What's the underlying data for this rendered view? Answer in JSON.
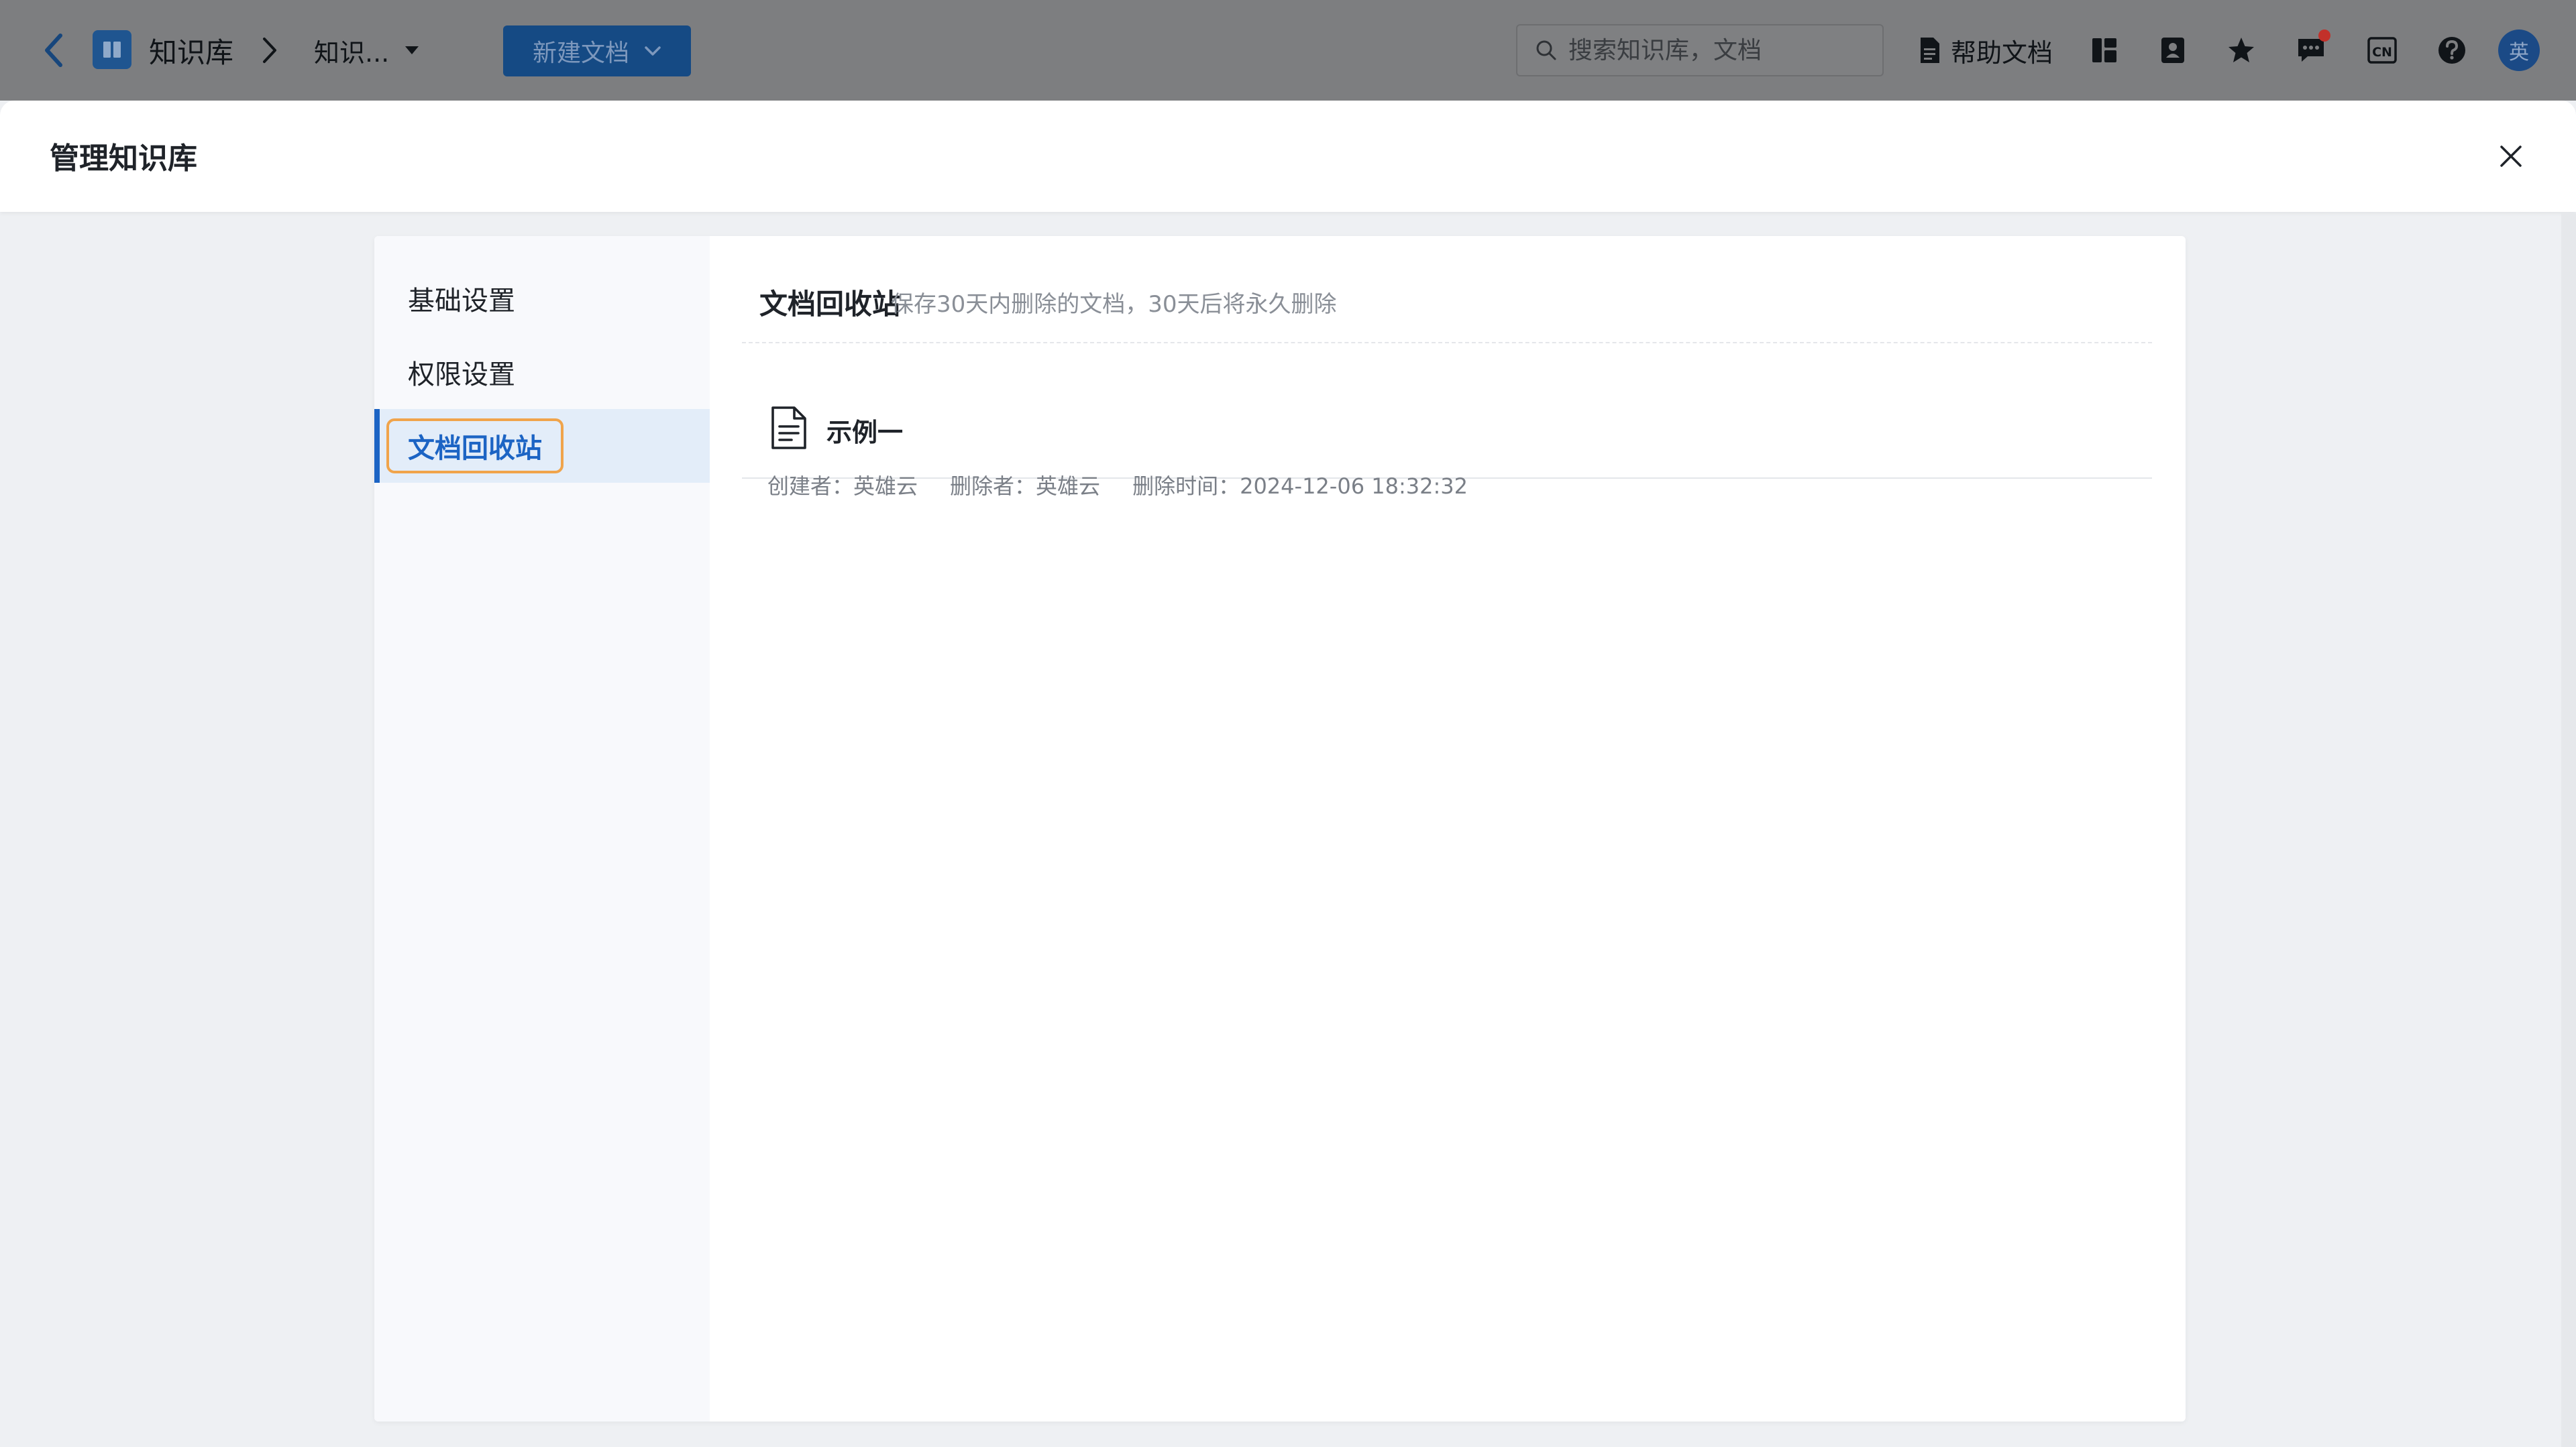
{
  "topbar": {
    "breadcrumb_root": "知识库",
    "breadcrumb_current": "知识...",
    "new_doc_label": "新建文档",
    "search_placeholder": "搜索知识库，文档",
    "help_docs_label": "帮助文档",
    "avatar_text": "英",
    "language_badge": "CN"
  },
  "modal": {
    "title": "管理知识库"
  },
  "sidebar": {
    "items": [
      {
        "label": "基础设置",
        "active": false
      },
      {
        "label": "权限设置",
        "active": false
      },
      {
        "label": "文档回收站",
        "active": true
      }
    ]
  },
  "recycle_bin": {
    "title": "文档回收站",
    "subtitle": "保存30天内删除的文档，30天后将永久删除",
    "items": [
      {
        "title": "示例一",
        "creator_label": "创建者：",
        "creator": "英雄云",
        "deleter_label": "删除者：",
        "deleter": "英雄云",
        "deleted_time_label": "删除时间：",
        "deleted_time": "2024-12-06 18:32:32"
      }
    ]
  },
  "colors": {
    "accent": "#1c64c4",
    "highlight_ring": "#f0a44b",
    "notification_dot": "#c2312a"
  }
}
